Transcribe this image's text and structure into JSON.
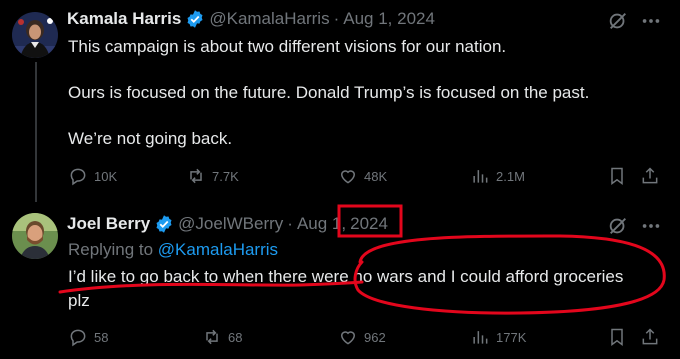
{
  "tweet1": {
    "name": "Kamala Harris",
    "handle": "@KamalaHarris",
    "sep": "·",
    "date": "Aug 1, 2024",
    "lines": [
      "This campaign is about two different visions for our nation.",
      "Ours is focused on the future. Donald Trump’s is focused on the past.",
      "We’re not going back."
    ],
    "stats": {
      "replies": "10K",
      "reposts": "7.7K",
      "likes": "48K",
      "views": "2.1M"
    }
  },
  "tweet2": {
    "name": "Joel Berry",
    "handle": "@JoelWBerry",
    "sep": "·",
    "date_month": "Aug 1,",
    "date_year": "2024",
    "replying_prefix": "Replying to",
    "replying_handle": "@KamalaHarris",
    "lines": [
      "I’d like to go back to when there were no wars and I could afford groceries",
      "plz"
    ],
    "stats": {
      "replies": "58",
      "reposts": "68",
      "likes": "962",
      "views": "177K"
    }
  },
  "icons": {
    "verified": "verified-badge-icon",
    "grok": "grok-icon",
    "more": "more-icon",
    "reply": "reply-icon",
    "repost": "repost-icon",
    "like": "like-icon",
    "views": "views-icon",
    "bookmark": "bookmark-icon",
    "share": "share-icon"
  },
  "colors": {
    "background": "#000000",
    "text": "#e7e9ea",
    "muted": "#71767b",
    "accent": "#1d9bf0",
    "annotation": "#e3061c"
  }
}
